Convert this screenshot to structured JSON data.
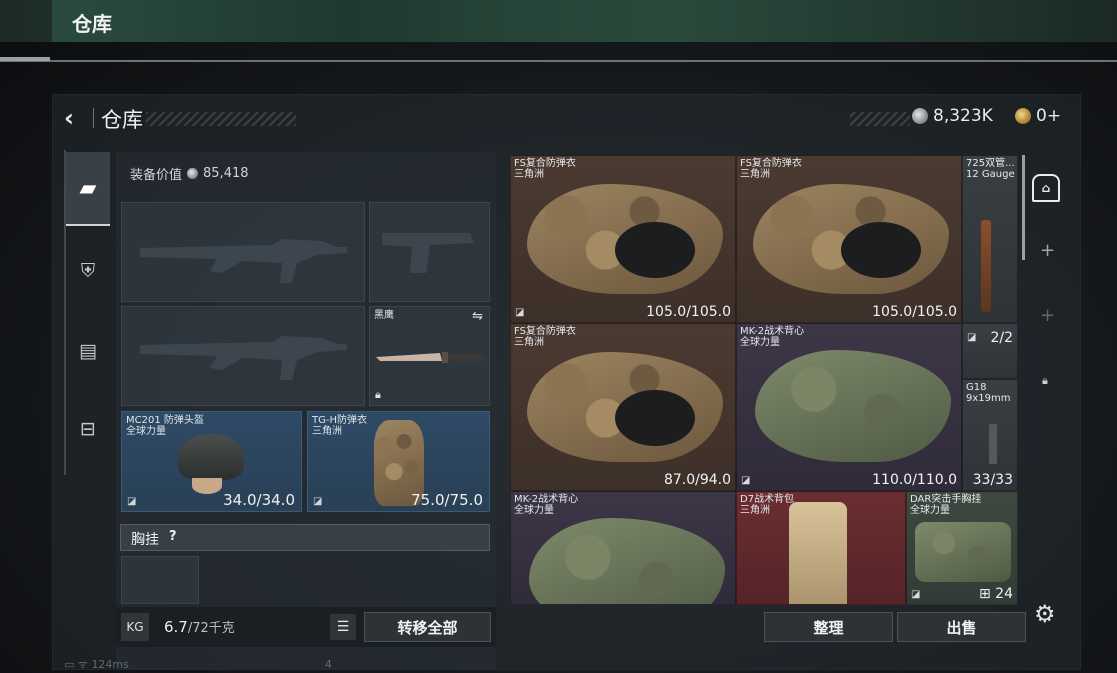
{
  "topbar": {
    "title": "仓库"
  },
  "header": {
    "back_icon": "‹",
    "title": "仓库",
    "silver_amount": "8,323K",
    "gold_amount": "0+"
  },
  "left_tabs": [
    {
      "name": "weapons-tab-icon",
      "glyph": "🔫"
    },
    {
      "name": "gear-tab-icon",
      "glyph": "⛑"
    },
    {
      "name": "backpack-tab-icon",
      "glyph": "🎒"
    },
    {
      "name": "toolbox-tab-icon",
      "glyph": "🧰"
    }
  ],
  "equipment": {
    "value_label": "装备价值",
    "value": "85,418",
    "melee_label": "黑鹰",
    "helmet": {
      "name": "MC201 防弹头盔",
      "source": "全球力量",
      "durability": "34.0/34.0"
    },
    "armor": {
      "name": "TG-H防弹衣",
      "source": "三角洲",
      "durability": "75.0/75.0"
    },
    "chest_rig_label": "胸挂",
    "chest_rig_help": "?"
  },
  "bottom": {
    "weight": "6.7",
    "weight_max": "/72千克",
    "transfer_all": "转移全部",
    "sort": "整理",
    "sell": "出售"
  },
  "grid_items": {
    "fs1": {
      "name": "FS复合防弹衣",
      "source": "三角洲",
      "durability": "105.0/105.0"
    },
    "fs2": {
      "name": "FS复合防弹衣",
      "source": "三角洲",
      "durability": "105.0/105.0"
    },
    "shotgun": {
      "name": "725双管...",
      "ammo": "12 Gauge"
    },
    "fs3": {
      "name": "FS复合防弹衣",
      "source": "三角洲",
      "durability": "87.0/94.0"
    },
    "mk2a": {
      "name": "MK-2战术背心",
      "source": "全球力量",
      "durability": "110.0/110.0"
    },
    "count_cell": {
      "value": "2/2"
    },
    "g18": {
      "name": "G18",
      "ammo": "9x19mm",
      "count": "33/33"
    },
    "mk2b": {
      "name": "MK-2战术背心",
      "source": "全球力量"
    },
    "d7": {
      "name": "D7战术背包",
      "source": "三角洲"
    },
    "dar": {
      "name": "DAR突击手胸挂",
      "source": "全球力量",
      "count": "24"
    }
  },
  "status_bar": {
    "ping": "124ms",
    "number": "4"
  }
}
